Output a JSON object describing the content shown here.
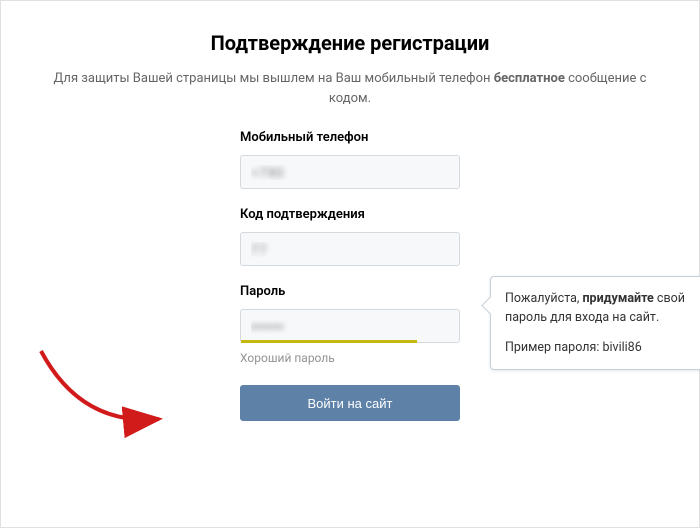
{
  "header": {
    "title": "Подтверждение регистрации",
    "subtitle_before": "Для защиты Вашей страницы мы вышлем на Ваш мобильный телефон ",
    "subtitle_bold": "бесплатное",
    "subtitle_after": " сообщение с кодом."
  },
  "form": {
    "phone": {
      "label": "Мобильный телефон",
      "value": "+790"
    },
    "code": {
      "label": "Код подтверждения",
      "value": "77"
    },
    "password": {
      "label": "Пароль",
      "value": "••••••",
      "strength_text": "Хороший пароль"
    },
    "submit_label": "Войти на сайт"
  },
  "tooltip": {
    "line1_before": "Пожалуйста, ",
    "line1_bold": "придумайте",
    "line1_after": " свой пароль для входа на сайт.",
    "line2_before": "Пример пароля: ",
    "line2_value": "bivili86"
  }
}
